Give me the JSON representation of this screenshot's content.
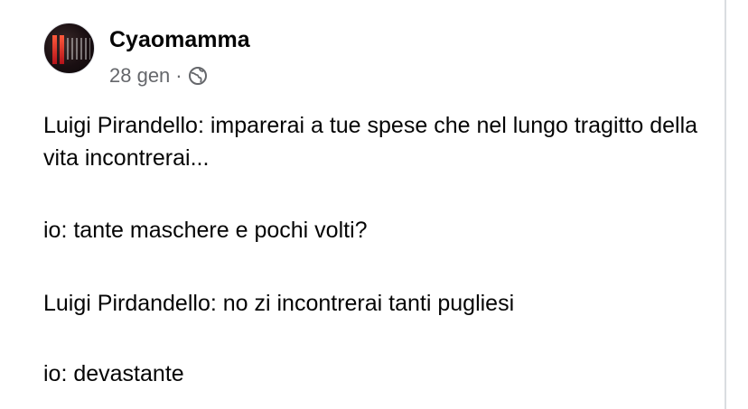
{
  "post": {
    "author": "Cyaomamma",
    "date": "28 gen",
    "separator": "·",
    "privacy_icon": "globe-icon",
    "paragraphs": [
      "Luigi Pirandello: imparerai a tue spese che nel lungo tragitto della vita incontrerai...",
      "io: tante maschere e pochi volti?",
      "Luigi Pirdandello: no zi incontrerai tanti pugliesi",
      "io: devastante"
    ]
  },
  "colors": {
    "text_primary": "#050505",
    "text_secondary": "#65676b",
    "border": "#dadde1"
  }
}
